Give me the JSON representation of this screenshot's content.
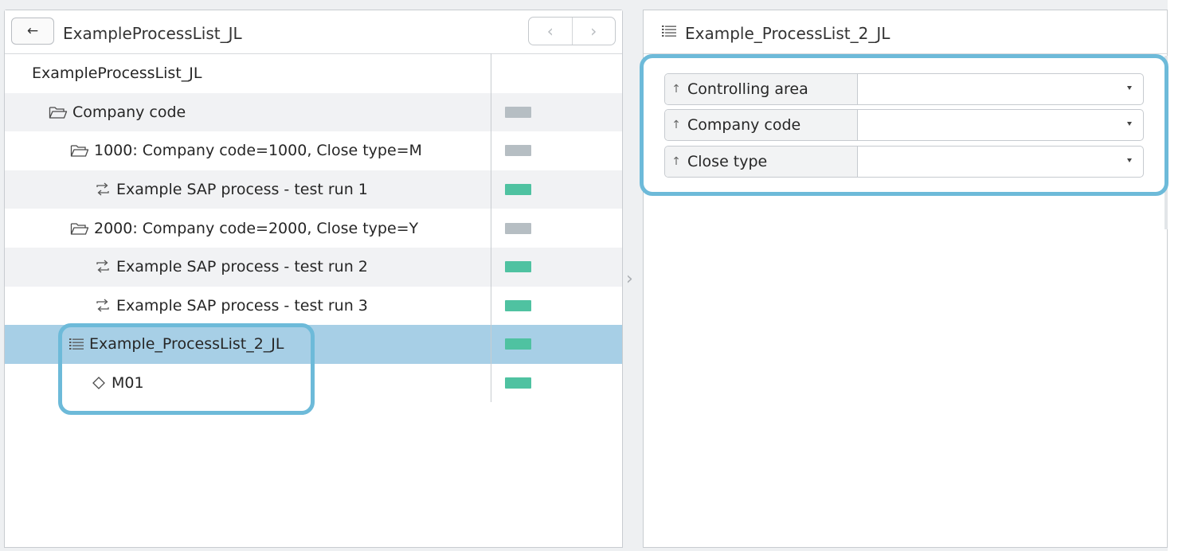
{
  "left": {
    "back_label": "←",
    "title": "ExampleProcessList_JL",
    "nav_prev": "‹",
    "nav_next": "›",
    "tree": [
      {
        "label": "ExampleProcessList_JL",
        "icon": "",
        "indent": 34,
        "status": null,
        "style": "plain"
      },
      {
        "label": "Company code",
        "icon": "folder-icon",
        "indent": 55,
        "status": "gray",
        "style": "alt"
      },
      {
        "label": "1000: Company code=1000, Close type=M",
        "icon": "folder-icon",
        "indent": 82,
        "status": "gray",
        "style": "plain"
      },
      {
        "label": "Example SAP process - test run 1",
        "icon": "process-icon",
        "indent": 112,
        "status": "green",
        "style": "alt"
      },
      {
        "label": "2000: Company code=2000, Close type=Y",
        "icon": "folder-icon",
        "indent": 82,
        "status": "gray",
        "style": "plain"
      },
      {
        "label": "Example SAP process - test run 2",
        "icon": "process-icon",
        "indent": 112,
        "status": "green",
        "style": "alt"
      },
      {
        "label": "Example SAP process - test run 3",
        "icon": "process-icon",
        "indent": 112,
        "status": "green",
        "style": "plain"
      },
      {
        "label": "Example_ProcessList_2_JL",
        "icon": "list-icon",
        "indent": 80,
        "status": "green",
        "style": "selected"
      },
      {
        "label": "M01",
        "icon": "diamond-icon",
        "indent": 108,
        "status": "green",
        "style": "plain"
      }
    ]
  },
  "right": {
    "title": "Example_ProcessList_2_JL",
    "params": [
      {
        "label": "Controlling area",
        "value": ""
      },
      {
        "label": "Company code",
        "value": ""
      },
      {
        "label": "Close type",
        "value": ""
      }
    ]
  },
  "colors": {
    "selected_row": "#a7cfe6",
    "status_gray": "#b6bec3",
    "status_green": "#4fc2a1",
    "highlight": "#6dbad9"
  }
}
